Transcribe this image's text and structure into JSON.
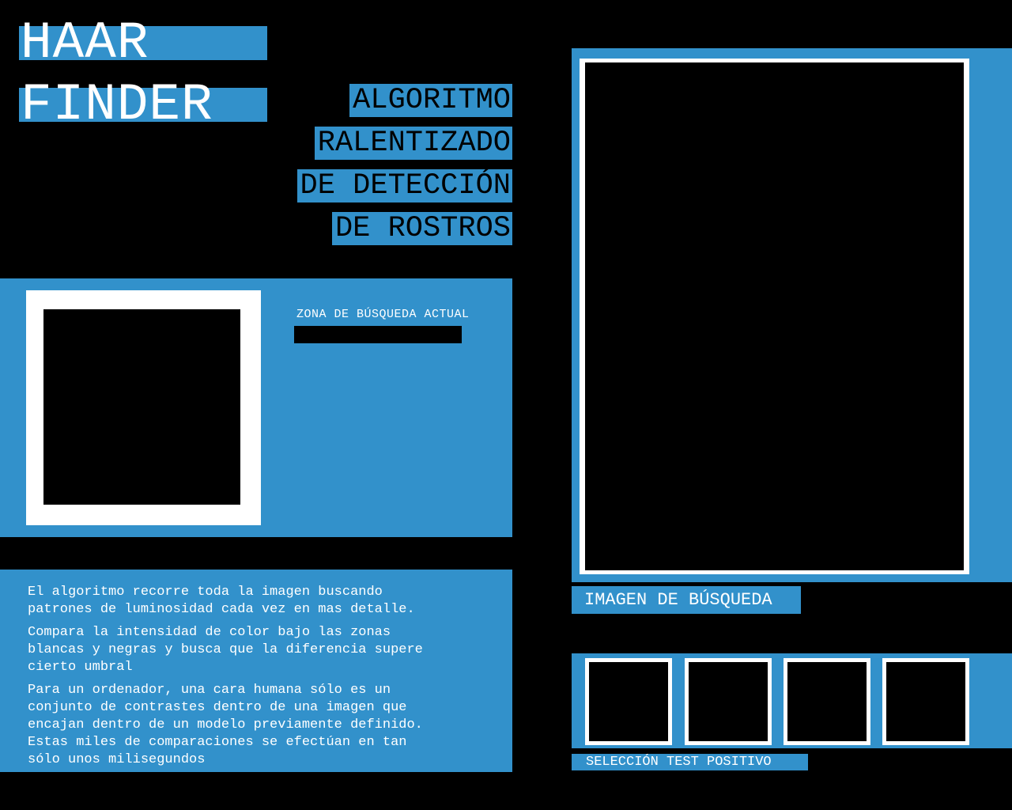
{
  "title": {
    "line1": "HAAR",
    "line2": "FINDER"
  },
  "subtitle": [
    "ALGORITMO",
    "RALENTIZADO",
    "DE DETECCIÓN",
    "DE ROSTROS"
  ],
  "current_zone": {
    "label": "ZONA DE BÚSQUEDA ACTUAL"
  },
  "description": [
    "El algoritmo recorre toda la imagen  buscando\npatrones de luminosidad  cada vez en mas detalle.",
    "Compara la intensidad de color bajo las zonas\nblancas y negras y busca que la diferencia supere\ncierto umbral",
    "Para un ordenador, una cara humana sólo es un\nconjunto  de contrastes dentro de una imagen que\nencajan dentro de un modelo previamente definido.\nEstas miles de comparaciones se efectúan en tan\nsólo unos milisegundos"
  ],
  "search_image": {
    "caption": "IMAGEN DE BÚSQUEDA"
  },
  "positive_tests": {
    "caption": "SELECCIÓN TEST POSITIVO",
    "count": 4
  },
  "colors": {
    "accent": "#3291cb",
    "background": "#000000",
    "frame": "#ffffff"
  }
}
